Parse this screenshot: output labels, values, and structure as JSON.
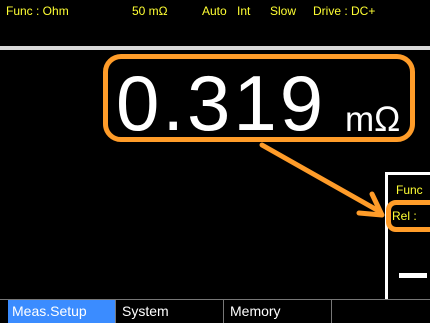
{
  "status": {
    "func": "Func : Ohm",
    "range": "50 mΩ",
    "auto": "Auto",
    "int": "Int",
    "speed": "Slow",
    "drive": "Drive : DC+"
  },
  "display": {
    "reading": "0.319",
    "unit": "mΩ"
  },
  "inset": {
    "func": "Func",
    "rel": "Rel :",
    "reading": "—"
  },
  "menu": {
    "meas_setup": "Meas.Setup",
    "system": "System",
    "memory": "Memory"
  },
  "colors": {
    "status_text": "#ffff33",
    "highlight": "#ff9c29",
    "active_tab": "#3b8cff",
    "background": "#000000"
  }
}
